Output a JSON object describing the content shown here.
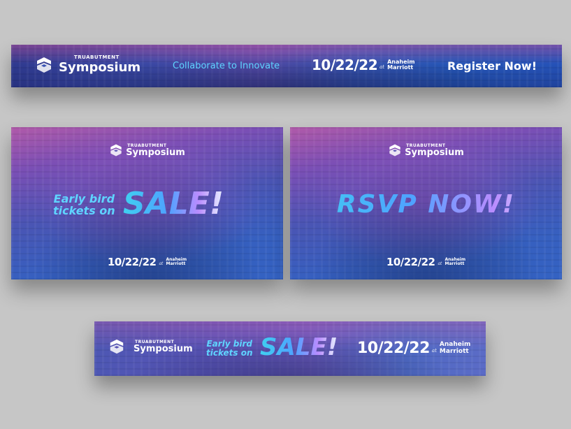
{
  "brand": {
    "small": "Truabutment",
    "big": "Symposium"
  },
  "event": {
    "date": "10/22/22",
    "at": "at",
    "venue_line1": "Anaheim",
    "venue_line2": "Marriott"
  },
  "banner1": {
    "tagline": "Collaborate to Innovate",
    "cta": "Register Now!"
  },
  "banner2": {
    "line1": "Early bird",
    "line2": "tickets on",
    "headline": "SALE!"
  },
  "banner3": {
    "headline": "RSVP NOW!"
  },
  "banner4": {
    "line1": "Early bird",
    "line2": "tickets on",
    "headline": "SALE!"
  },
  "colors": {
    "page_bg": "#c6c6c6",
    "accent_cyan": "#5fd4ff",
    "banner_blue": "#2f56b8",
    "banner_magenta": "#b05aa9"
  },
  "icons": {
    "logo": "abutment-logo-icon"
  }
}
